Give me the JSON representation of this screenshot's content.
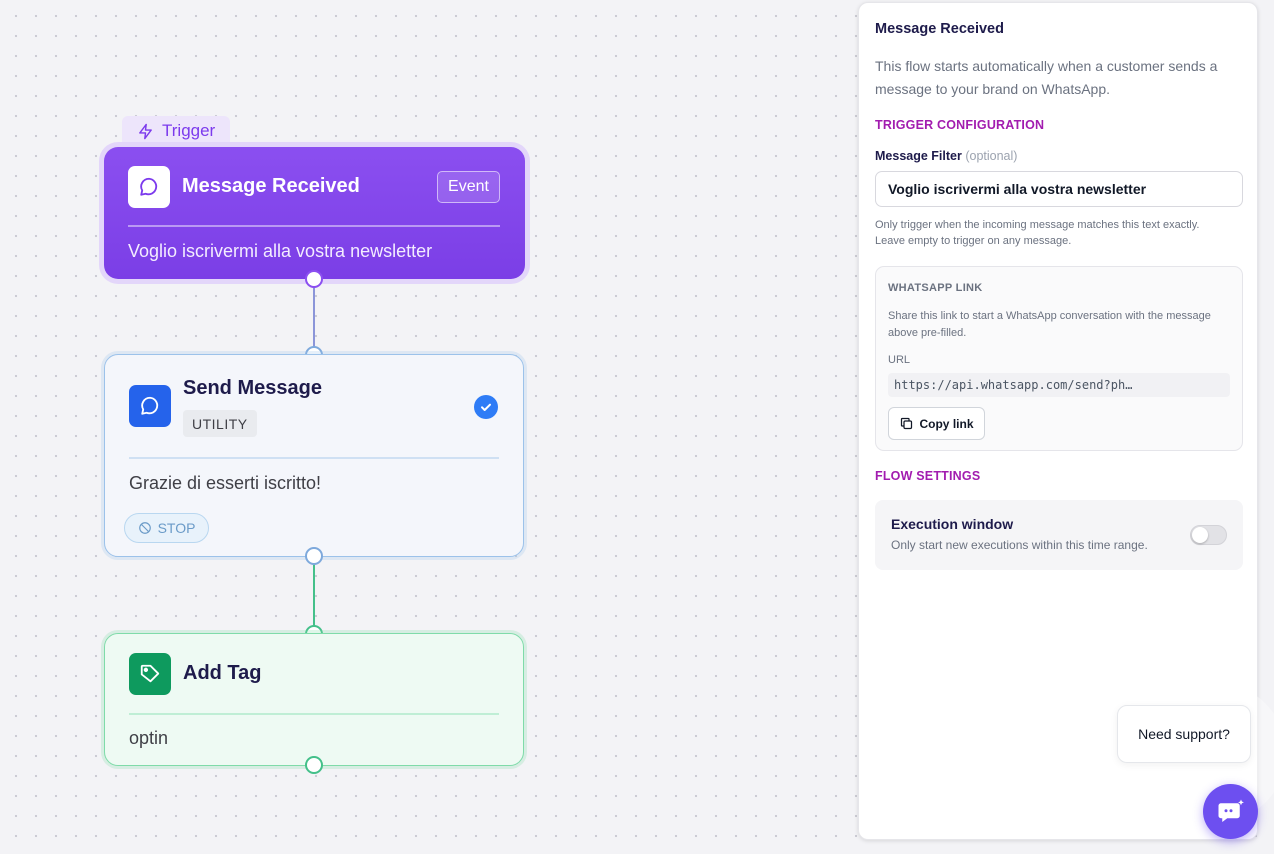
{
  "colors": {
    "trigger": "#7c3aed",
    "send": "#2563eb",
    "tag": "#059669",
    "section": "#a21caf"
  },
  "flow": {
    "trigger_tag": "Trigger",
    "trigger_node": {
      "title": "Message Received",
      "badge": "Event",
      "body": "Voglio iscrivermi alla vostra newsletter",
      "icon": "chat-bubble-icon"
    },
    "send_node": {
      "title": "Send Message",
      "badge": "UTILITY",
      "body": "Grazie di esserti iscritto!",
      "stop_label": "STOP",
      "icon": "chat-bubble-icon",
      "status_icon": "check-circle-icon"
    },
    "tag_node": {
      "title": "Add Tag",
      "body": "optin",
      "icon": "tag-icon"
    }
  },
  "panel": {
    "title": "Message Received",
    "description": "This flow starts automatically when a customer sends a message to your brand on WhatsApp.",
    "trigger_section": "TRIGGER CONFIGURATION",
    "filter_label": "Message Filter",
    "filter_optional": "(optional)",
    "filter_value": "Voglio iscrivermi alla vostra newsletter",
    "filter_help_1": "Only trigger when the incoming message matches this text exactly.",
    "filter_help_2": "Leave empty to trigger on any message.",
    "whatsapp_link": {
      "title": "WHATSAPP LINK",
      "description": "Share this link to start a WhatsApp conversation with the message above pre-filled.",
      "url_label": "URL",
      "url": "https://api.whatsapp.com/send?ph…",
      "copy_label": "Copy link"
    },
    "flow_section": "FLOW SETTINGS",
    "execution": {
      "title": "Execution window",
      "description": "Only start new executions within this time range.",
      "enabled": false
    }
  },
  "support": {
    "bubble_text": "Need support?"
  }
}
